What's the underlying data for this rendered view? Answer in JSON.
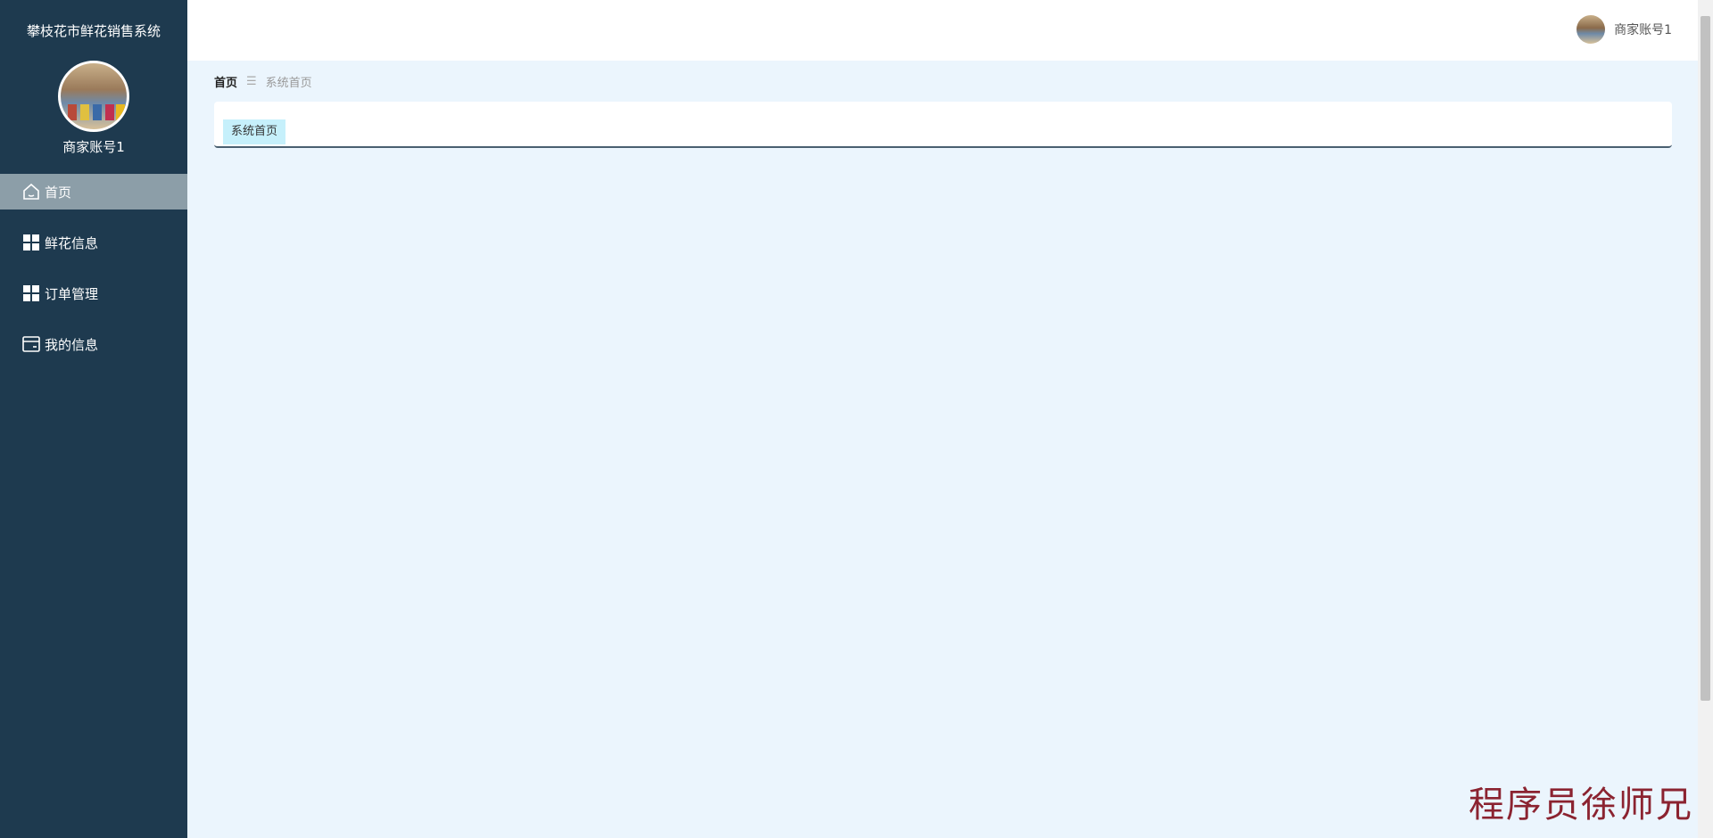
{
  "sidebar": {
    "app_title": "攀枝花市鲜花销售系统",
    "user_name": "商家账号1",
    "items": [
      {
        "label": "首页",
        "icon": "home-icon",
        "active": true
      },
      {
        "label": "鲜花信息",
        "icon": "grid-icon",
        "active": false
      },
      {
        "label": "订单管理",
        "icon": "grid-icon",
        "active": false
      },
      {
        "label": "我的信息",
        "icon": "card-icon",
        "active": false
      }
    ]
  },
  "header": {
    "user_name": "商家账号1"
  },
  "breadcrumb": {
    "home": "首页",
    "separator": "☰",
    "current": "系统首页"
  },
  "tabs": [
    {
      "label": "系统首页"
    }
  ],
  "watermark": "程序员徐师兄",
  "colors": {
    "sidebar_bg": "#1e3a4f",
    "active_item_bg": "#8c9ea8",
    "content_bg": "#ebf5fd",
    "tab_bg": "#c6f0fb",
    "watermark": "#8b2330"
  }
}
